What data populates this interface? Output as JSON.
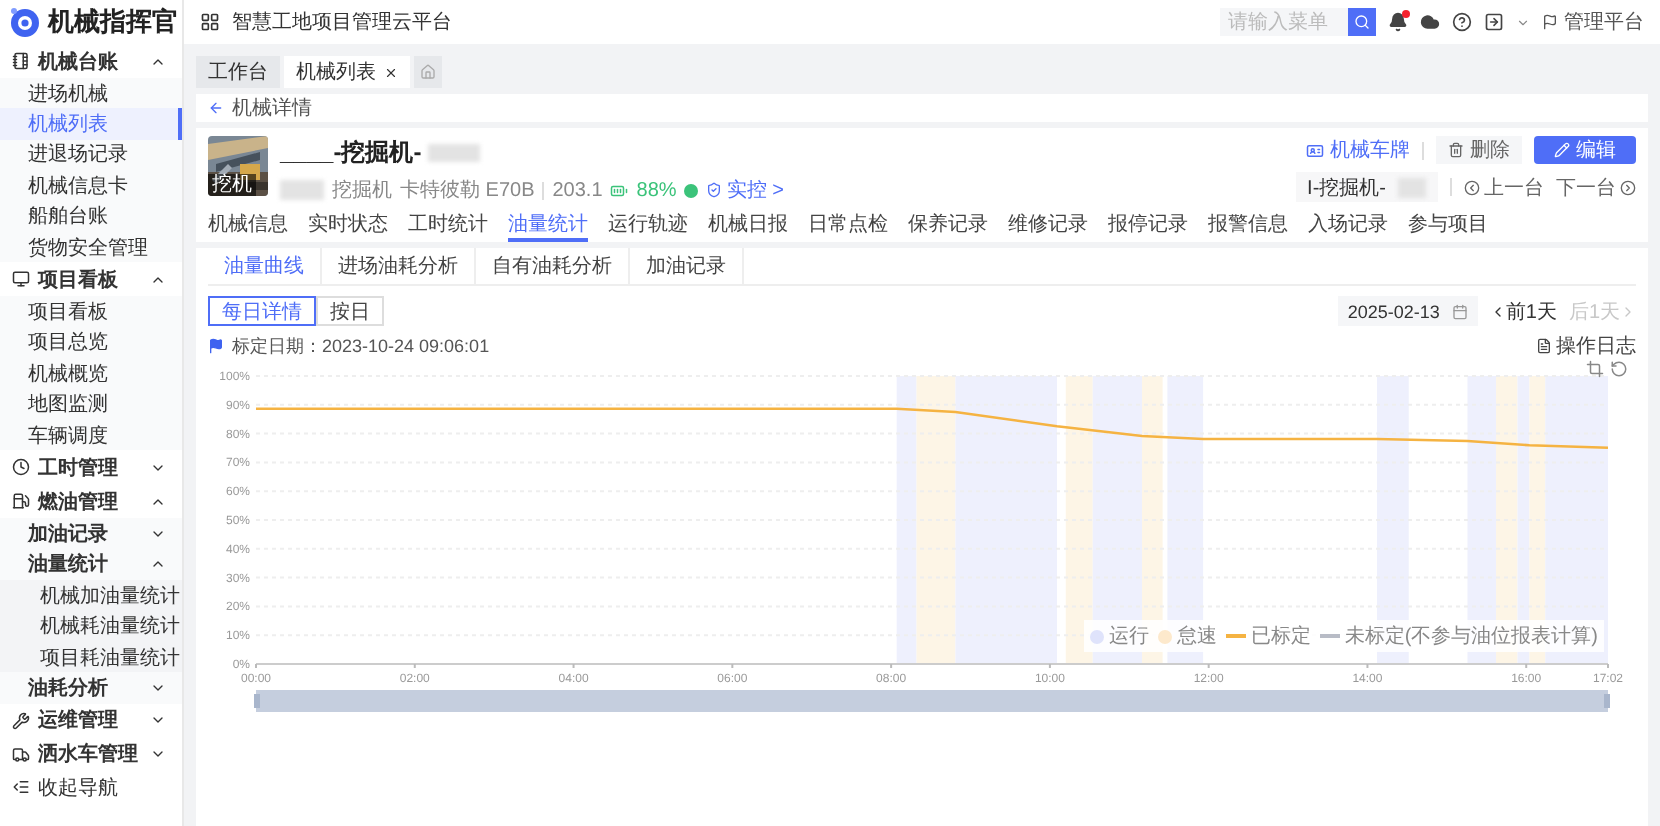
{
  "brand": {
    "name": "机械指挥官"
  },
  "header": {
    "title": "智慧工地项目管理云平台",
    "search": {
      "placeholder": "请输入菜单"
    },
    "platform_link": "管理平台"
  },
  "sidebar": {
    "groups": [
      {
        "label": "机械台账",
        "expanded": true,
        "children": [
          {
            "label": "进场机械",
            "selected": false
          },
          {
            "label": "机械列表",
            "selected": true
          },
          {
            "label": "进退场记录",
            "selected": false
          },
          {
            "label": "机械信息卡",
            "selected": false
          },
          {
            "label": "船舶台账",
            "selected": false
          },
          {
            "label": "货物安全管理",
            "selected": false
          }
        ]
      },
      {
        "label": "项目看板",
        "expanded": true,
        "children": [
          {
            "label": "项目看板",
            "selected": false
          },
          {
            "label": "项目总览",
            "selected": false
          },
          {
            "label": "机械概览",
            "selected": false
          },
          {
            "label": "地图监测",
            "selected": false
          },
          {
            "label": "车辆调度",
            "selected": false
          }
        ]
      },
      {
        "label": "工时管理",
        "expanded": false
      },
      {
        "label": "燃油管理",
        "expanded": true,
        "children": [
          {
            "label": "加油记录",
            "selected": false,
            "expanded": false
          },
          {
            "label": "油量统计",
            "selected": false,
            "expanded": true,
            "children": [
              {
                "label": "机械加油量统计",
                "selected": false
              },
              {
                "label": "机械耗油量统计",
                "selected": false
              },
              {
                "label": "项目耗油量统计",
                "selected": false
              }
            ]
          },
          {
            "label": "油耗分析",
            "selected": false,
            "expanded": false
          }
        ]
      },
      {
        "label": "运维管理",
        "expanded": false
      },
      {
        "label": "洒水车管理",
        "expanded": false
      }
    ],
    "collapse_label": "收起导航"
  },
  "page_tabs": [
    {
      "label": "工作台",
      "selected": false,
      "closable": false
    },
    {
      "label": "机械列表",
      "selected": true,
      "closable": true
    }
  ],
  "breadcrumb": "机械详情",
  "machine": {
    "photo_caption": "挖机",
    "title": "____-挖掘机-",
    "type": "挖掘机",
    "brand_model": "卡特彼勒 E70B",
    "reading": "203.1",
    "battery": "88%",
    "control_link": "实控 >",
    "plate_button": "机械车牌",
    "delete_button": "删除",
    "edit_button": "编辑",
    "selector_value": "I-挖掘机-",
    "prev": "上一台",
    "next": "下一台"
  },
  "detail_tabs": [
    {
      "label": "机械信息",
      "selected": false
    },
    {
      "label": "实时状态",
      "selected": false
    },
    {
      "label": "工时统计",
      "selected": false
    },
    {
      "label": "油量统计",
      "selected": true
    },
    {
      "label": "运行轨迹",
      "selected": false
    },
    {
      "label": "机械日报",
      "selected": false
    },
    {
      "label": "日常点检",
      "selected": false
    },
    {
      "label": "保养记录",
      "selected": false
    },
    {
      "label": "维修记录",
      "selected": false
    },
    {
      "label": "报停记录",
      "selected": false
    },
    {
      "label": "报警信息",
      "selected": false
    },
    {
      "label": "入场记录",
      "selected": false
    },
    {
      "label": "参与项目",
      "selected": false
    }
  ],
  "sub_tabs": [
    {
      "label": "油量曲线",
      "selected": true
    },
    {
      "label": "进场油耗分析",
      "selected": false
    },
    {
      "label": "自有油耗分析",
      "selected": false
    },
    {
      "label": "加油记录",
      "selected": false
    }
  ],
  "view_toggle": [
    {
      "label": "每日详情",
      "selected": true
    },
    {
      "label": "按日",
      "selected": false
    }
  ],
  "date_picker": {
    "value": "2025-02-13"
  },
  "prev_day": {
    "label": "前1天",
    "disabled": false
  },
  "next_day": {
    "label": "后1天",
    "disabled": true
  },
  "calibration": "标定日期：2023-10-24 09:06:01",
  "log_link": "操作日志",
  "chart": {
    "chart_data": {
      "type": "line",
      "x": [
        0,
        8.07,
        8.81,
        10.09,
        11.16,
        11.93,
        14.12,
        15.26,
        16.04,
        17.03
      ],
      "series": [
        {
          "name": "已标定",
          "color": "#f5b342",
          "values": [
            88.6,
            88.6,
            87.5,
            82.6,
            79.2,
            78.1,
            78.1,
            77.4,
            76.0,
            75.1
          ]
        },
        {
          "name": "未标定(不参与油位报表计算)",
          "color": "#b8bcc6",
          "values": [
            null,
            null,
            null,
            null,
            null,
            null,
            null,
            null,
            null,
            null
          ]
        }
      ],
      "grid": true,
      "xlim": [
        0,
        17.03
      ],
      "ylim": [
        0,
        100
      ],
      "xticks": [
        {
          "value": 0,
          "label": "00:00"
        },
        {
          "value": 2,
          "label": "02:00"
        },
        {
          "value": 4,
          "label": "04:00"
        },
        {
          "value": 6,
          "label": "06:00"
        },
        {
          "value": 8,
          "label": "08:00"
        },
        {
          "value": 10,
          "label": "10:00"
        },
        {
          "value": 12,
          "label": "12:00"
        },
        {
          "value": 14,
          "label": "14:00"
        },
        {
          "value": 16,
          "label": "16:00"
        },
        {
          "value": 17.03,
          "label": "17:02"
        }
      ],
      "yticks": [
        {
          "value": 0,
          "label": "0%"
        },
        {
          "value": 10,
          "label": "10%"
        },
        {
          "value": 20,
          "label": "20%"
        },
        {
          "value": 30,
          "label": "30%"
        },
        {
          "value": 40,
          "label": "40%"
        },
        {
          "value": 50,
          "label": "50%"
        },
        {
          "value": 60,
          "label": "60%"
        },
        {
          "value": 70,
          "label": "70%"
        },
        {
          "value": 80,
          "label": "80%"
        },
        {
          "value": 90,
          "label": "90%"
        },
        {
          "value": 100,
          "label": "100%"
        }
      ],
      "bands": [
        {
          "axis": "x",
          "from": 8.07,
          "to": 8.32,
          "color": "#eef0fd"
        },
        {
          "axis": "x",
          "from": 8.32,
          "to": 8.81,
          "color": "#fdf5e6"
        },
        {
          "axis": "x",
          "from": 8.81,
          "to": 10.09,
          "color": "#eef0fd"
        },
        {
          "axis": "x",
          "from": 10.2,
          "to": 10.54,
          "color": "#fdf5e6"
        },
        {
          "axis": "x",
          "from": 10.54,
          "to": 11.16,
          "color": "#eef0fd"
        },
        {
          "axis": "x",
          "from": 11.16,
          "to": 11.42,
          "color": "#fdf5e6"
        },
        {
          "axis": "x",
          "from": 11.48,
          "to": 11.93,
          "color": "#eef0fd"
        },
        {
          "axis": "x",
          "from": 14.12,
          "to": 14.52,
          "color": "#eef0fd"
        },
        {
          "axis": "x",
          "from": 15.26,
          "to": 15.62,
          "color": "#eef0fd"
        },
        {
          "axis": "x",
          "from": 15.62,
          "to": 15.89,
          "color": "#fdf5e6"
        },
        {
          "axis": "x",
          "from": 15.89,
          "to": 16.04,
          "color": "#eef0fd"
        },
        {
          "axis": "x",
          "from": 16.04,
          "to": 16.24,
          "color": "#fdf5e6"
        },
        {
          "axis": "x",
          "from": 16.24,
          "to": 17.03,
          "color": "#eef0fd"
        }
      ]
    },
    "legend": [
      {
        "label": "运行",
        "color": "#dfe3fb"
      },
      {
        "label": "怠速",
        "color": "#fde9cc"
      }
    ]
  }
}
